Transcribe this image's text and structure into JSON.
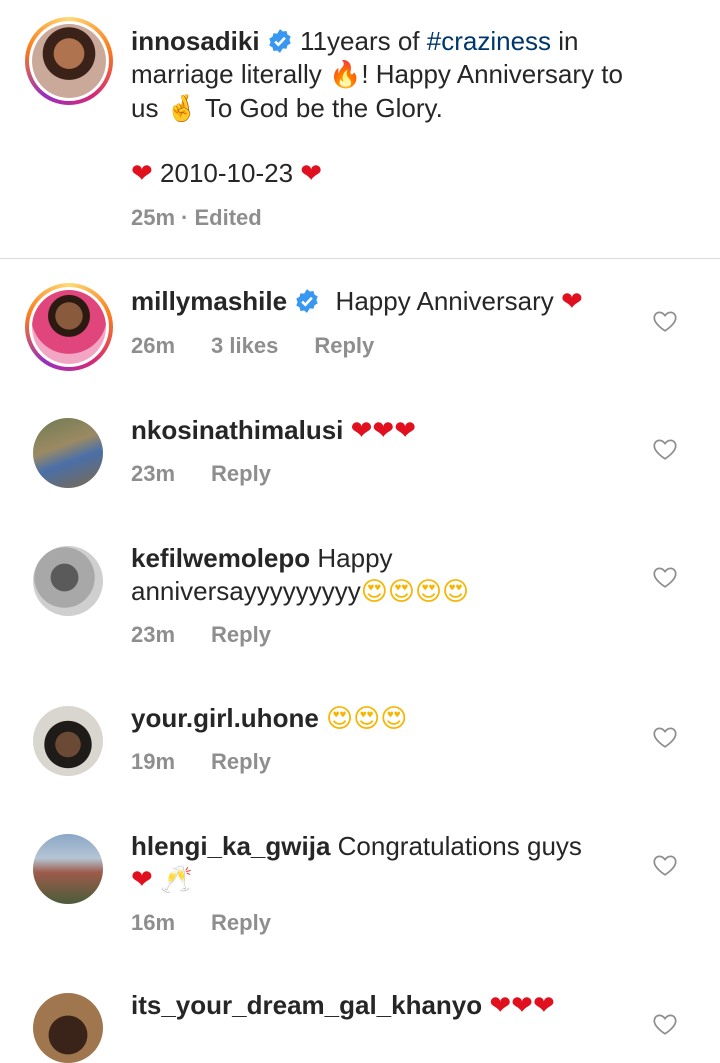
{
  "caption": {
    "username": "innosadiki",
    "text_before_tag": " 11years of ",
    "hashtag": "#craziness",
    "text_line1_end": " in",
    "text_line2": "marriage literally ",
    "text_line2_after": "! Happy Anniversary to",
    "text_line3_before": "us ",
    "text_line3": " To God be the Glory.",
    "date_line": "2010-10-23",
    "time": "25m",
    "edited": "· Edited"
  },
  "comments": [
    {
      "username": "millymashile",
      "verified": true,
      "text": "Happy Anniversary ",
      "emoji": "❤",
      "time": "26m",
      "likes": "3 likes",
      "reply": "Reply"
    },
    {
      "username": "nkosinathimalusi",
      "verified": false,
      "text": "",
      "emoji": "❤❤❤",
      "time": "23m",
      "likes": "",
      "reply": "Reply"
    },
    {
      "username": "kefilwemolepo",
      "verified": false,
      "text": "Happy",
      "text2": "anniversayyyyyyyyy",
      "emoji": "😍😍😍😍",
      "time": "23m",
      "likes": "",
      "reply": "Reply"
    },
    {
      "username": "your.girl.uhone",
      "verified": false,
      "text": "",
      "emoji": "😍😍😍",
      "time": "19m",
      "likes": "",
      "reply": "Reply"
    },
    {
      "username": "hlengi_ka_gwija",
      "verified": false,
      "text": "Congratulations guys",
      "emoji": "❤",
      "emoji2": "🥂",
      "time": "16m",
      "likes": "",
      "reply": "Reply"
    },
    {
      "username": "its_your_dream_gal_khanyo",
      "verified": false,
      "text": "",
      "emoji": "❤❤❤",
      "time": "",
      "likes": "",
      "reply": ""
    }
  ],
  "icons": {
    "verified": "verified-badge-icon",
    "like": "heart-outline-icon"
  },
  "colors": {
    "verified": "#3897f0",
    "hashtag": "#00376b",
    "meta": "#8e8e8e",
    "heart": "#e0101e"
  }
}
